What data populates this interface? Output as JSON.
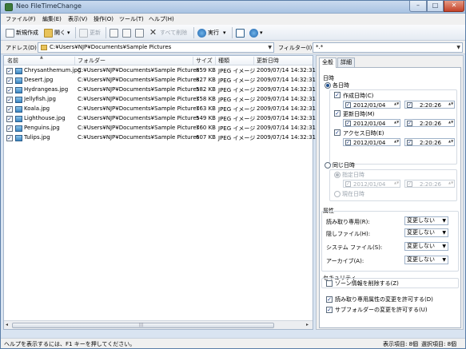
{
  "window": {
    "title": "Neo FileTimeChange",
    "close_glyph": "✕",
    "minimize_glyph": "–",
    "maximize_glyph": "□"
  },
  "menu": [
    "ファイル(F)",
    "編集(E)",
    "表示(V)",
    "操作(O)",
    "ツール(T)",
    "ヘルプ(H)"
  ],
  "toolbar": {
    "new_label": "新規作成",
    "open_label": "開く",
    "refresh_label": "更新",
    "delete_all_label": "すべて削除",
    "run_label": "実行",
    "dropdown_glyph": "▾"
  },
  "address": {
    "label": "アドレス(D)",
    "value": "C:¥Users¥NJP¥Documents¥Sample Pictures",
    "filter_label": "フィルター(I)",
    "filter_value": "*.*"
  },
  "list": {
    "columns": [
      "名前",
      "フォルダー",
      "サイズ",
      "種類",
      "更新日時"
    ],
    "rows": [
      {
        "name": "Chrysanthemum.jpg",
        "folder": "C:¥Users¥NJP¥Documents¥Sample Pictures",
        "size": "859 KB",
        "type": "JPEG イメージ",
        "modified": "2009/07/14 14:32:31"
      },
      {
        "name": "Desert.jpg",
        "folder": "C:¥Users¥NJP¥Documents¥Sample Pictures",
        "size": "827 KB",
        "type": "JPEG イメージ",
        "modified": "2009/07/14 14:32:31"
      },
      {
        "name": "Hydrangeas.jpg",
        "folder": "C:¥Users¥NJP¥Documents¥Sample Pictures",
        "size": "582 KB",
        "type": "JPEG イメージ",
        "modified": "2009/07/14 14:32:31"
      },
      {
        "name": "Jellyfish.jpg",
        "folder": "C:¥Users¥NJP¥Documents¥Sample Pictures",
        "size": "758 KB",
        "type": "JPEG イメージ",
        "modified": "2009/07/14 14:32:31"
      },
      {
        "name": "Koala.jpg",
        "folder": "C:¥Users¥NJP¥Documents¥Sample Pictures",
        "size": "763 KB",
        "type": "JPEG イメージ",
        "modified": "2009/07/14 14:32:31"
      },
      {
        "name": "Lighthouse.jpg",
        "folder": "C:¥Users¥NJP¥Documents¥Sample Pictures",
        "size": "549 KB",
        "type": "JPEG イメージ",
        "modified": "2009/07/14 14:32:31"
      },
      {
        "name": "Penguins.jpg",
        "folder": "C:¥Users¥NJP¥Documents¥Sample Pictures",
        "size": "760 KB",
        "type": "JPEG イメージ",
        "modified": "2009/07/14 14:32:31"
      },
      {
        "name": "Tulips.jpg",
        "folder": "C:¥Users¥NJP¥Documents¥Sample Pictures",
        "size": "607 KB",
        "type": "JPEG イメージ",
        "modified": "2009/07/14 14:32:31"
      }
    ],
    "check_glyph": "✓",
    "scroll_left": "◂",
    "scroll_right": "▸",
    "thumb_grip": "|||"
  },
  "panel": {
    "tabs": [
      "全般",
      "詳細"
    ],
    "datetime_title": "日時",
    "each_datetime": "各日時",
    "created": "作成日時(C)",
    "modified": "更新日時(M)",
    "accessed": "アクセス日時(E)",
    "date_value": "2012/01/04",
    "time_value": "2:20:26",
    "same_datetime": "同じ日時",
    "specified_datetime": "指定日時",
    "current_datetime": "現在日時",
    "attributes_title": "属性",
    "readonly": "読み取り専用(R):",
    "hidden": "隠しファイル(H):",
    "system": "システム ファイル(S):",
    "archive": "アーカイブ(A):",
    "no_change": "変更しない",
    "security_title": "セキュリティ",
    "remove_zone": "ゾーン情報を削除する(Z)",
    "allow_readonly_change": "読み取り専用属性の変更を許可する(D)",
    "allow_subfolder_change": "サブフォルダーの変更を許可する(U)",
    "spin_glyph": "▲▼"
  },
  "status": {
    "help": "ヘルプを表示するには、F1 キーを押してください。",
    "count": "表示項目: 8個",
    "selected": "選択項目: 8個"
  }
}
